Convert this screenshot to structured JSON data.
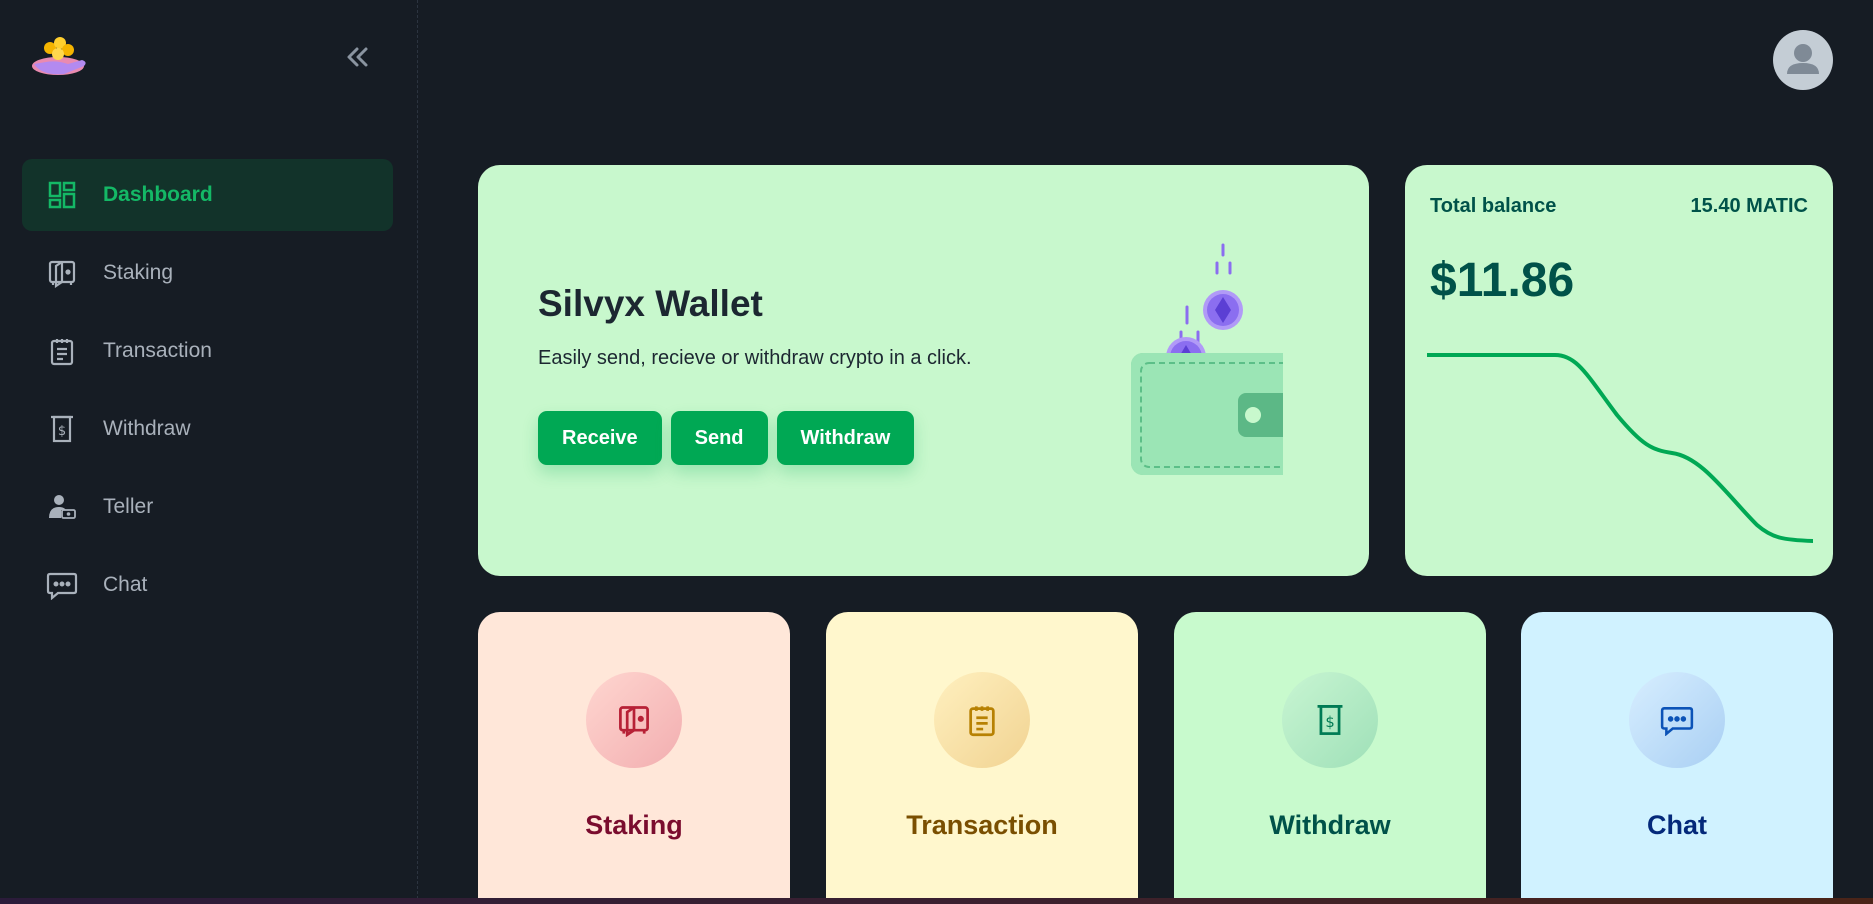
{
  "app": {
    "title": "Silvyx Wallet"
  },
  "sidebar": {
    "items": [
      {
        "label": "Dashboard",
        "icon": "dashboard-icon",
        "active": true
      },
      {
        "label": "Staking",
        "icon": "staking-icon",
        "active": false
      },
      {
        "label": "Transaction",
        "icon": "transaction-icon",
        "active": false
      },
      {
        "label": "Withdraw",
        "icon": "withdraw-icon",
        "active": false
      },
      {
        "label": "Teller",
        "icon": "teller-icon",
        "active": false
      },
      {
        "label": "Chat",
        "icon": "chat-icon",
        "active": false
      }
    ]
  },
  "hero": {
    "title": "Silvyx Wallet",
    "subtitle": "Easily send, recieve or withdraw crypto in a click.",
    "buttons": {
      "receive": "Receive",
      "send": "Send",
      "withdraw": "Withdraw"
    }
  },
  "balance": {
    "label": "Total balance",
    "matic": "15.40 MATIC",
    "amount": "$11.86"
  },
  "tiles": [
    {
      "label": "Staking",
      "icon": "staking-icon",
      "bg": "#ffe7d9",
      "color": "#7a0c2e"
    },
    {
      "label": "Transaction",
      "icon": "transaction-icon",
      "bg": "#fff7cd",
      "color": "#7a4f01"
    },
    {
      "label": "Withdraw",
      "icon": "withdraw-icon",
      "bg": "#c8facd",
      "color": "#005249"
    },
    {
      "label": "Chat",
      "icon": "chat-icon",
      "bg": "#d0f2ff",
      "color": "#04297a"
    }
  ],
  "colors": {
    "accent": "#00a854",
    "background": "#161c24"
  }
}
